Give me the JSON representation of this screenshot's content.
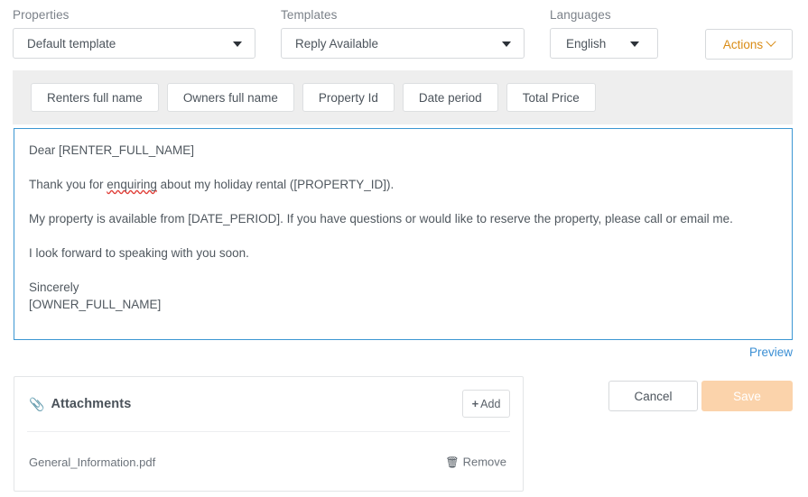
{
  "toolbar_fields": {
    "properties": {
      "label": "Properties",
      "value": "Default template",
      "caret_icon": "chevron-down-icon"
    },
    "templates": {
      "label": "Templates",
      "value": "Reply Available",
      "caret_icon": "chevron-down-icon"
    },
    "languages": {
      "label": "Languages",
      "value": "English",
      "caret_icon": "chevron-down-icon"
    },
    "actions": {
      "label": "Actions",
      "caret_icon": "chevron-down-icon"
    }
  },
  "placeholder_tags": [
    {
      "label": "Renters full name"
    },
    {
      "label": "Owners full name"
    },
    {
      "label": "Property Id"
    },
    {
      "label": "Date period"
    },
    {
      "label": "Total Price"
    }
  ],
  "editor": {
    "paragraphs": [
      {
        "id": "greeting",
        "text": "Dear [RENTER_FULL_NAME]"
      },
      {
        "id": "thanks",
        "prefix": "Thank you for ",
        "misspelled": "enquiring",
        "suffix": " about my holiday rental ([PROPERTY_ID])."
      },
      {
        "id": "availability",
        "text": "My property is available from [DATE_PERIOD]. If you have questions or would like to reserve the property, please call or email me."
      },
      {
        "id": "closing",
        "text": "I look forward to speaking with you soon."
      },
      {
        "id": "signoff",
        "line1": "Sincerely",
        "line2": "[OWNER_FULL_NAME]"
      }
    ],
    "preview_label": "Preview"
  },
  "attachments": {
    "title": "Attachments",
    "title_icon": "paperclip-icon",
    "add_button": {
      "label": "Add",
      "icon": "plus-icon"
    },
    "files": [
      {
        "name": "General_Information.pdf",
        "remove_label": "Remove",
        "remove_icon": "trash-icon"
      }
    ]
  },
  "footer": {
    "cancel_label": "Cancel",
    "save_label": "Save"
  },
  "colors": {
    "accent_blue": "#3b97d3",
    "link_blue": "#3b8fd4",
    "actions_orange": "#d98c16",
    "save_disabled": "#fbd3ab",
    "toolbar_grey": "#eeeeee"
  }
}
